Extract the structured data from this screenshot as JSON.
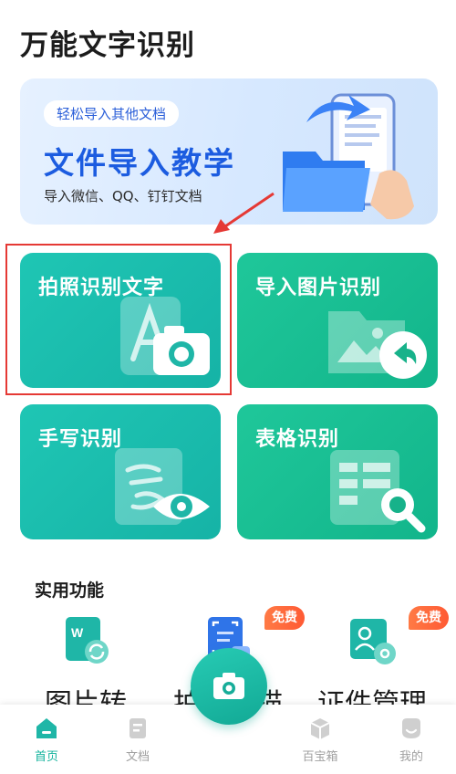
{
  "app": {
    "title": "万能文字识别"
  },
  "banner": {
    "tag": "轻松导入其他文档",
    "title": "文件导入教学",
    "subtitle": "导入微信、QQ、钉钉文档"
  },
  "features": [
    {
      "label": "拍照识别文字",
      "icon": "camera-text-icon"
    },
    {
      "label": "导入图片识别",
      "icon": "folder-import-icon"
    },
    {
      "label": "手写识别",
      "icon": "handwriting-eye-icon"
    },
    {
      "label": "表格识别",
      "icon": "table-search-icon"
    }
  ],
  "tools": {
    "section_title": "实用功能",
    "items": [
      {
        "label": "图片转",
        "icon": "word-convert-icon"
      },
      {
        "label": "拍照扫描",
        "icon": "scan-doc-icon",
        "badge": "免费"
      },
      {
        "label": "证件管理",
        "icon": "id-card-icon",
        "badge": "免费"
      }
    ]
  },
  "bottom_nav": {
    "items": [
      {
        "label": "首页",
        "icon": "home-icon",
        "active": true
      },
      {
        "label": "文档",
        "icon": "document-icon"
      },
      {
        "label": "百宝箱",
        "icon": "treasure-box-icon"
      },
      {
        "label": "我的",
        "icon": "profile-icon"
      }
    ],
    "camera_icon": "camera-icon"
  },
  "colors": {
    "teal": "#16b3a6",
    "green": "#12b58b",
    "brand_blue": "#1c5ce0",
    "badge_orange": "#ff5a34",
    "annotation_red": "#e53935"
  }
}
